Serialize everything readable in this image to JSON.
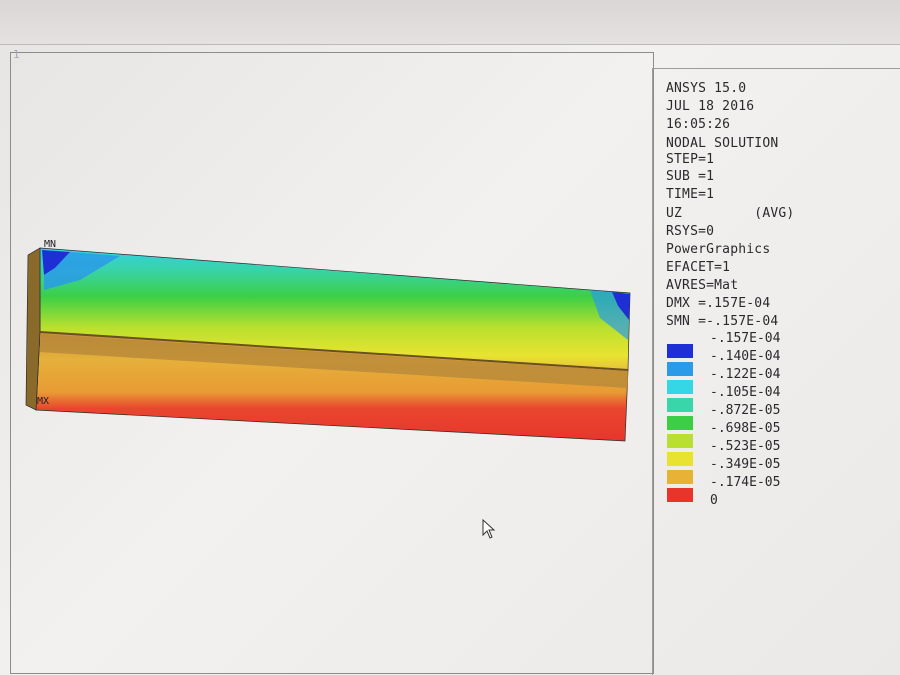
{
  "window": {
    "number": "1"
  },
  "info": {
    "lines": [
      "ANSYS 15.0",
      "JUL 18 2016",
      "16:05:26",
      "NODAL SOLUTION",
      "STEP=1",
      "SUB =1",
      "TIME=1",
      "UZ         (AVG)",
      "RSYS=0",
      "PowerGraphics",
      "EFACET=1",
      "AVRES=Mat",
      "DMX =.157E-04",
      "SMN =-.157E-04"
    ]
  },
  "legend": {
    "top_label": "-.157E-04",
    "items": [
      {
        "label": "-.140E-04",
        "color": "#1f2fd6"
      },
      {
        "label": "-.122E-04",
        "color": "#2a9be8"
      },
      {
        "label": "-.105E-04",
        "color": "#35d6e6"
      },
      {
        "label": "-.872E-05",
        "color": "#38d6a8"
      },
      {
        "label": "-.698E-05",
        "color": "#3ccf46"
      },
      {
        "label": "-.523E-05",
        "color": "#b9e02e"
      },
      {
        "label": "-.349E-05",
        "color": "#e8e331"
      },
      {
        "label": "-.174E-05",
        "color": "#e8b236"
      },
      {
        "label": "0",
        "color": "#e8352c"
      }
    ]
  },
  "model": {
    "min_label": "MN",
    "max_label": "MX"
  },
  "colors": {
    "background": "#eeecea",
    "frame": "#8d8b8b",
    "text": "#2a2a2e"
  }
}
